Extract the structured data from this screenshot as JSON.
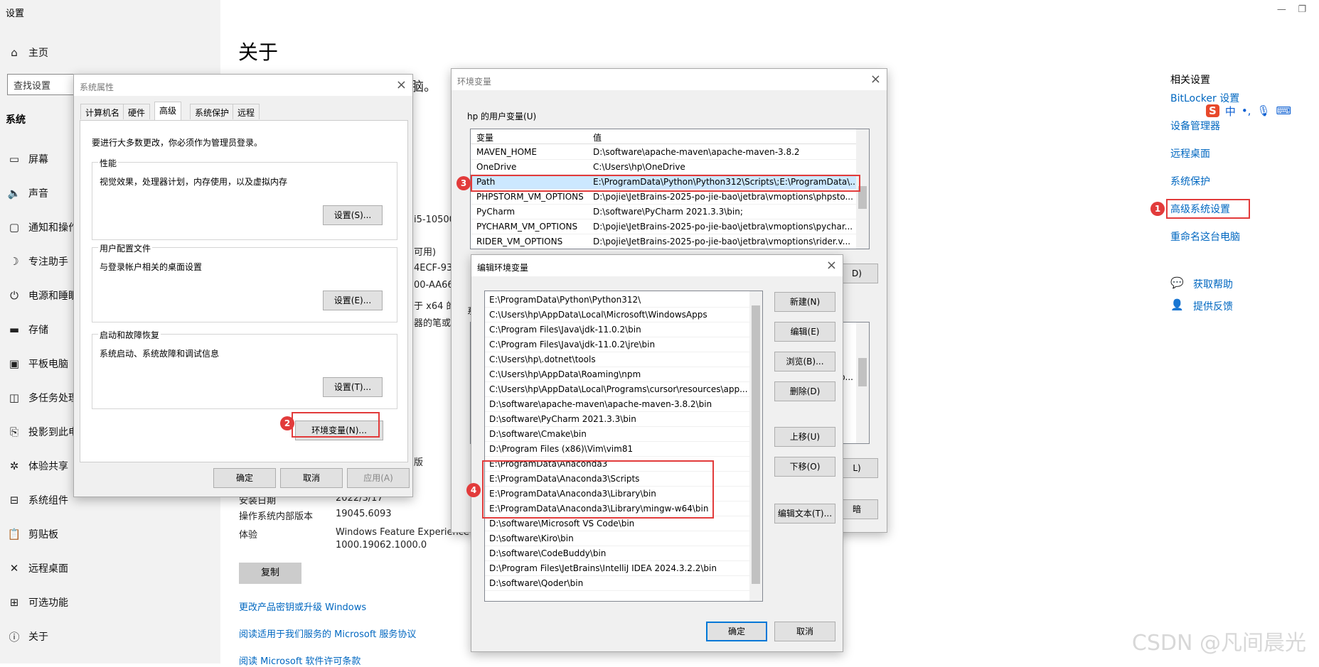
{
  "settings": {
    "title": "设置",
    "home": "主页",
    "search_placeholder": "查找设置",
    "section": "系统",
    "nav": [
      {
        "label": "屏幕",
        "icon": "monitor-icon",
        "glyph": "▭"
      },
      {
        "label": "声音",
        "icon": "speaker-icon",
        "glyph": "🔈"
      },
      {
        "label": "通知和操作",
        "icon": "notification-icon",
        "glyph": "▢"
      },
      {
        "label": "专注助手",
        "icon": "moon-icon",
        "glyph": "☽"
      },
      {
        "label": "电源和睡眠",
        "icon": "power-icon",
        "glyph": "⏻"
      },
      {
        "label": "存储",
        "icon": "storage-icon",
        "glyph": "▬"
      },
      {
        "label": "平板电脑",
        "icon": "tablet-icon",
        "glyph": "▣"
      },
      {
        "label": "多任务处理",
        "icon": "multitask-icon",
        "glyph": "◫"
      },
      {
        "label": "投影到此电脑",
        "icon": "project-icon",
        "glyph": "⎘"
      },
      {
        "label": "体验共享",
        "icon": "share-icon",
        "glyph": "✲"
      },
      {
        "label": "系统组件",
        "icon": "components-icon",
        "glyph": "⊟"
      },
      {
        "label": "剪贴板",
        "icon": "clipboard-icon",
        "glyph": "📋"
      },
      {
        "label": "远程桌面",
        "icon": "remote-icon",
        "glyph": "✕"
      },
      {
        "label": "可选功能",
        "icon": "features-icon",
        "glyph": "⊞"
      },
      {
        "label": "关于",
        "icon": "info-icon",
        "glyph": "ⓘ"
      }
    ],
    "main_title": "关于",
    "partial_texts": [
      "脑。",
      "i5-10500",
      "可用)",
      "4ECF-932",
      "00-AA66",
      "于 x64 的",
      "器的笔或",
      "版"
    ],
    "info": [
      {
        "label": "安装日期",
        "value": "2022/3/17"
      },
      {
        "label": "操作系统内部版本",
        "value": "19045.6093"
      },
      {
        "label": "体验",
        "value": "Windows Feature Experience Pack"
      },
      {
        "label": "",
        "value": "1000.19062.1000.0"
      }
    ],
    "copy_button": "复制",
    "links": [
      "更改产品密钥或升级 Windows",
      "阅读适用于我们服务的 Microsoft 服务协议",
      "阅读 Microsoft 软件许可条款"
    ],
    "related_title": "相关设置",
    "related": [
      "BitLocker 设置",
      "设备管理器",
      "远程桌面",
      "系统保护",
      "高级系统设置",
      "重命名这台电脑"
    ],
    "help": "获取帮助",
    "feedback": "提供反馈",
    "ime": "中"
  },
  "sysprops": {
    "title": "系统属性",
    "tabs": [
      "计算机名",
      "硬件",
      "高级",
      "系统保护",
      "远程"
    ],
    "admin_note": "要进行大多数更改，你必须作为管理员登录。",
    "performance": {
      "label": "性能",
      "desc": "视觉效果，处理器计划，内存使用，以及虚拟内存",
      "button": "设置(S)..."
    },
    "profile": {
      "label": "用户配置文件",
      "desc": "与登录帐户相关的桌面设置",
      "button": "设置(E)..."
    },
    "startup": {
      "label": "启动和故障恢复",
      "desc": "系统启动、系统故障和调试信息",
      "button": "设置(T)..."
    },
    "env_button": "环境变量(N)...",
    "ok": "确定",
    "cancel": "取消",
    "apply": "应用(A)"
  },
  "envvars": {
    "title": "环境变量",
    "user_group": "hp 的用户变量(U)",
    "col_var": "变量",
    "col_val": "值",
    "rows": [
      {
        "name": "MAVEN_HOME",
        "value": "D:\\software\\apache-maven\\apache-maven-3.8.2"
      },
      {
        "name": "OneDrive",
        "value": "C:\\Users\\hp\\OneDrive"
      },
      {
        "name": "Path",
        "value": "E:\\ProgramData\\Python\\Python312\\Scripts\\;E:\\ProgramData\\..."
      },
      {
        "name": "PHPSTORM_VM_OPTIONS",
        "value": "D:\\pojie\\JetBrains-2025-po-jie-bao\\jetbra\\vmoptions\\phpsto..."
      },
      {
        "name": "PyCharm",
        "value": "D:\\software\\PyCharm 2021.3.3\\bin;"
      },
      {
        "name": "PYCHARM_VM_OPTIONS",
        "value": "D:\\pojie\\JetBrains-2025-po-jie-bao\\jetbra\\vmoptions\\pychar..."
      },
      {
        "name": "RIDER_VM_OPTIONS",
        "value": "D:\\pojie\\JetBrains-2025-po-jie-bao\\jetbra\\vmoptions\\rider.v..."
      }
    ],
    "partial_buttons": [
      "D)",
      "b...",
      "L)",
      "暗"
    ],
    "partial_label": "系"
  },
  "editenv": {
    "title": "编辑环境变量",
    "entries": [
      "E:\\ProgramData\\Python\\Python312\\",
      "C:\\Users\\hp\\AppData\\Local\\Microsoft\\WindowsApps",
      "C:\\Program Files\\Java\\jdk-11.0.2\\bin",
      "C:\\Program Files\\Java\\jdk-11.0.2\\jre\\bin",
      "C:\\Users\\hp\\.dotnet\\tools",
      "C:\\Users\\hp\\AppData\\Roaming\\npm",
      "C:\\Users\\hp\\AppData\\Local\\Programs\\cursor\\resources\\app...",
      "D:\\software\\apache-maven\\apache-maven-3.8.2\\bin",
      "D:\\software\\PyCharm 2021.3.3\\bin",
      "D:\\software\\Cmake\\bin",
      "D:\\Program Files (x86)\\Vim\\vim81",
      "E:\\ProgramData\\Anaconda3",
      "E:\\ProgramData\\Anaconda3\\Scripts",
      "E:\\ProgramData\\Anaconda3\\Library\\bin",
      "E:\\ProgramData\\Anaconda3\\Library\\mingw-w64\\bin",
      "D:\\software\\Microsoft VS Code\\bin",
      "D:\\software\\Kiro\\bin",
      "D:\\software\\CodeBuddy\\bin",
      "D:\\Program Files\\JetBrains\\IntelliJ IDEA 2024.3.2.2\\bin",
      "D:\\software\\Qoder\\bin"
    ],
    "buttons": [
      "新建(N)",
      "编辑(E)",
      "浏览(B)...",
      "删除(D)",
      "上移(U)",
      "下移(O)",
      "编辑文本(T)..."
    ],
    "ok": "确定",
    "cancel": "取消"
  },
  "annotations": [
    "1",
    "2",
    "3",
    "4"
  ],
  "watermark": "CSDN @凡间晨光",
  "colors": {
    "accent": "#0067c0",
    "highlight": "#e23b3b"
  }
}
